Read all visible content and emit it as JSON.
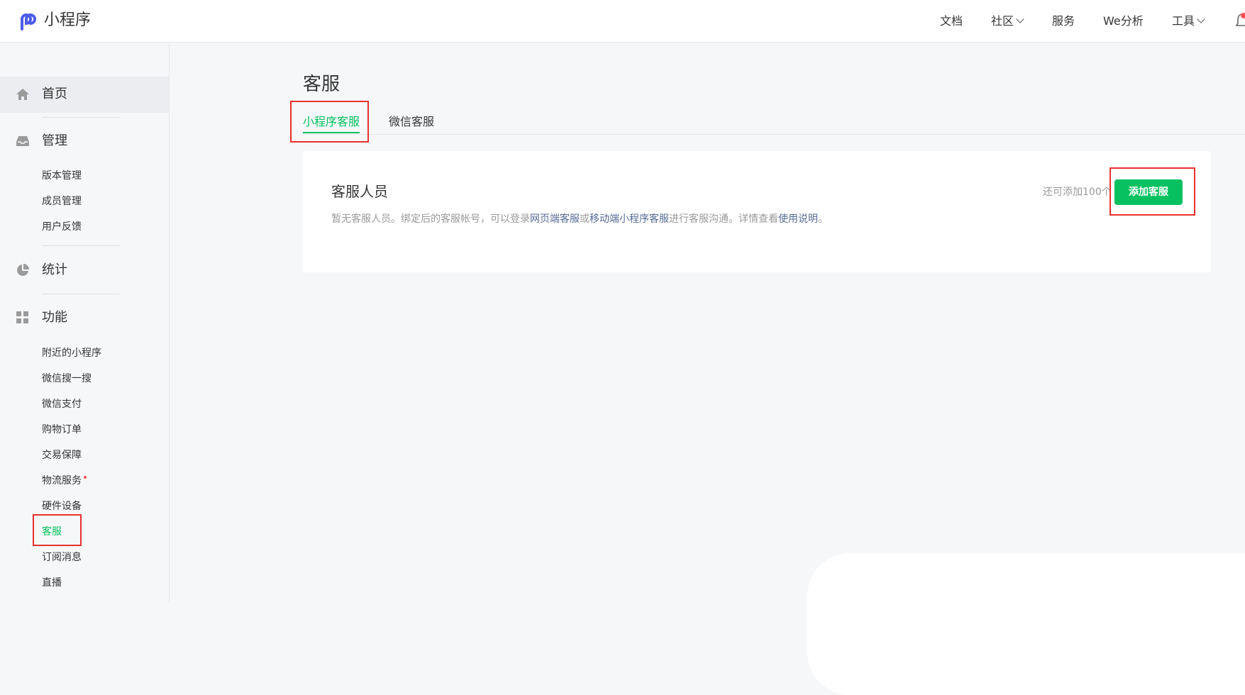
{
  "header": {
    "brand": "小程序",
    "nav": [
      {
        "label": "文档"
      },
      {
        "label": "社区"
      },
      {
        "label": "服务"
      },
      {
        "label": "We分析"
      },
      {
        "label": "工具"
      }
    ]
  },
  "sidebar": {
    "sections": [
      {
        "title": "首页",
        "icon": "home-icon"
      },
      {
        "title": "管理",
        "icon": "inbox-icon",
        "items": [
          "版本管理",
          "成员管理",
          "用户反馈"
        ]
      },
      {
        "title": "统计",
        "icon": "pie-chart-icon"
      },
      {
        "title": "功能",
        "icon": "grid-icon",
        "items": [
          "附近的小程序",
          "微信搜一搜",
          "微信支付",
          "购物订单",
          "交易保障",
          "物流服务",
          "硬件设备",
          "客服",
          "订阅消息",
          "直播"
        ]
      }
    ],
    "active_item": "客服"
  },
  "main": {
    "title": "客服",
    "tabs": [
      {
        "label": "小程序客服",
        "active": true
      },
      {
        "label": "微信客服",
        "active": false
      }
    ],
    "card": {
      "title": "客服人员",
      "desc_prefix": "暂无客服人员。绑定后的客服帐号，可以登录",
      "link_web": "网页端客服",
      "desc_or": "或",
      "link_mobile": "移动端小程序客服",
      "desc_middle": "进行客服沟通。详情查看",
      "link_help": "使用说明",
      "desc_end": "。",
      "remaining_text": "还可添加100个",
      "add_button": "添加客服"
    }
  },
  "colors": {
    "accent": "#07c160",
    "link": "#576b95",
    "highlight": "#e8322f"
  }
}
